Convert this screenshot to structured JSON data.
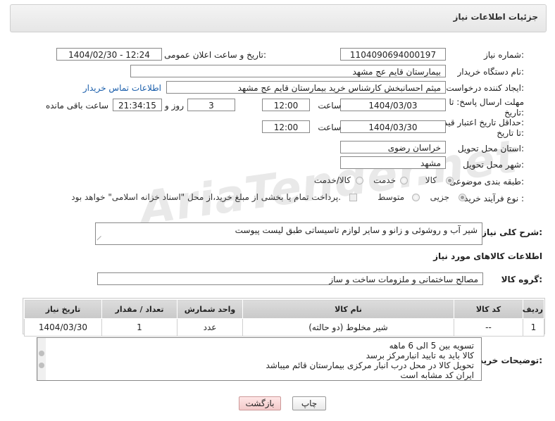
{
  "header": {
    "title": "جزئیات اطلاعات نیاز"
  },
  "watermark": "AriaTender.net",
  "form": {
    "need_number_label": "شماره نیاز:",
    "need_number": "1104090694000197",
    "announce_label": "تاریخ و ساعت اعلان عمومی:",
    "announce_value": "1404/02/30 - 12:24",
    "buyer_org_label": "نام دستگاه خریدار:",
    "buyer_org": "بیمارستان قایم  عج  مشهد",
    "creator_label": "ایجاد کننده درخواست:",
    "creator": "میثم احسانبخش کارشناس خرید بیمارستان قایم  عج  مشهد",
    "contact_link": "اطلاعات تماس خریدار",
    "deadline_label_line1": "مهلت ارسال پاسخ: تا",
    "deadline_label_line2": "تاریخ:",
    "deadline_date": "1404/03/03",
    "time_label": "ساعت",
    "deadline_time": "12:00",
    "days_value": "3",
    "days_label": "روز و",
    "remaining_time": "21:34:15",
    "remaining_label": "ساعت باقی مانده",
    "validity_label_line1": "حداقل تاریخ اعتبار قیمت:",
    "validity_label_line2": "تا تاریخ:",
    "validity_date": "1404/03/30",
    "validity_time": "12:00",
    "province_label": "استان محل تحویل:",
    "province": "خراسان رضوی",
    "city_label": "شهر محل تحویل:",
    "city": "مشهد",
    "category_label": "طبقه بندی موضوعی:",
    "category_options": [
      "کالا",
      "خدمت",
      "کالا/خدمت"
    ],
    "process_label": "نوع فرآیند خرید :",
    "process_options": [
      "جزیی",
      "متوسط"
    ],
    "payment_note": "پرداخت تمام یا بخشی از مبلغ خرید،از محل \"اسناد خزانه اسلامی\" خواهد بود."
  },
  "summary": {
    "label": "شرح کلی نیاز:",
    "text": "شیر آب و روشوئی و زانو و سایر لوازم تاسیساتی طبق لیست پیوست"
  },
  "goods": {
    "section_title": "اطلاعات کالاهای مورد نیاز",
    "group_label": "گروه کالا:",
    "group_value": "مصالح ساختمانی و ملزومات ساخت و ساز",
    "columns": [
      "ردیف",
      "کد کالا",
      "نام کالا",
      "واحد شمارش",
      "تعداد / مقدار",
      "تاریخ نیاز"
    ],
    "rows": [
      [
        "1",
        "--",
        "شیر مخلوط (دو حالته)",
        "عدد",
        "1",
        "1404/03/30"
      ]
    ]
  },
  "buyer_notes": {
    "label": "توضیحات خریدار:",
    "lines": [
      "تسویه بین 5 الی 6 ماهه",
      "کالا باید به تایید انبارمرکز برسد",
      "تحویل کالا در محل درب انبار مرکزی بیمارستان قائم میباشد",
      "ایران کد مشابه است"
    ]
  },
  "buttons": {
    "print": "چاپ",
    "back": "بازگشت"
  }
}
